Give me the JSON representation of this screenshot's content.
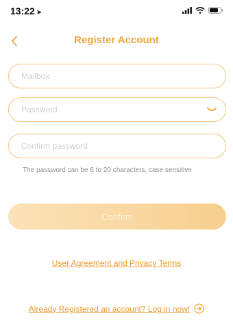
{
  "status_bar": {
    "time": "13:22",
    "icons": [
      "location-arrow-icon",
      "signal-icon",
      "wifi-icon",
      "battery-icon"
    ]
  },
  "nav": {
    "back_icon": "chevron-left-icon",
    "title": "Register Account"
  },
  "form": {
    "mailbox_placeholder": "Mailbox",
    "mailbox_value": "",
    "password_placeholder": "Password",
    "password_value": "",
    "password_toggle_icon": "eye-closed-icon",
    "confirm_placeholder": "Confirm password",
    "confirm_value": "",
    "hint": "The password can be 6 to 20 characters, case sensitive",
    "confirm_label": "Confirm"
  },
  "links": {
    "agreement": "User Agreement and Privacy Terms",
    "login": "Already Registered an account? Log in now!",
    "login_icon": "arrow-right-circle-icon"
  },
  "colors": {
    "accent": "#f0a63c",
    "field_border": "#f3c27c",
    "button_start": "#fbe2b8",
    "button_end": "#f7cf8e",
    "hint_text": "#8c8c8c"
  }
}
